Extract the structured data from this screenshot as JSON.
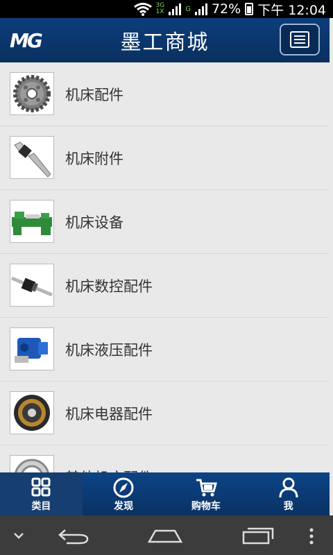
{
  "status": {
    "battery": "72%",
    "time": "下午 12:04",
    "net_top": "3G",
    "net_bottom": "1X",
    "net_g": "G"
  },
  "header": {
    "title": "墨工商城",
    "logo_text": "MG"
  },
  "categories": [
    {
      "label": "机床配件",
      "icon": "gear-image"
    },
    {
      "label": "机床附件",
      "icon": "live-center-image"
    },
    {
      "label": "机床设备",
      "icon": "lathe-image"
    },
    {
      "label": "机床数控配件",
      "icon": "ballscrew-image"
    },
    {
      "label": "机床液压配件",
      "icon": "hydraulic-pump-image"
    },
    {
      "label": "机床电器配件",
      "icon": "electric-clutch-image"
    },
    {
      "label": "其他机床配件",
      "icon": "bearing-image"
    }
  ],
  "bottom_nav": [
    {
      "label": "类目",
      "icon": "grid-icon",
      "active": true
    },
    {
      "label": "发现",
      "icon": "compass-icon"
    },
    {
      "label": "购物车",
      "icon": "cart-icon"
    },
    {
      "label": "我",
      "icon": "user-icon"
    }
  ],
  "colors": {
    "header": "#0c3e7b",
    "nav": "#0d4385",
    "background": "#e9e9e9"
  }
}
